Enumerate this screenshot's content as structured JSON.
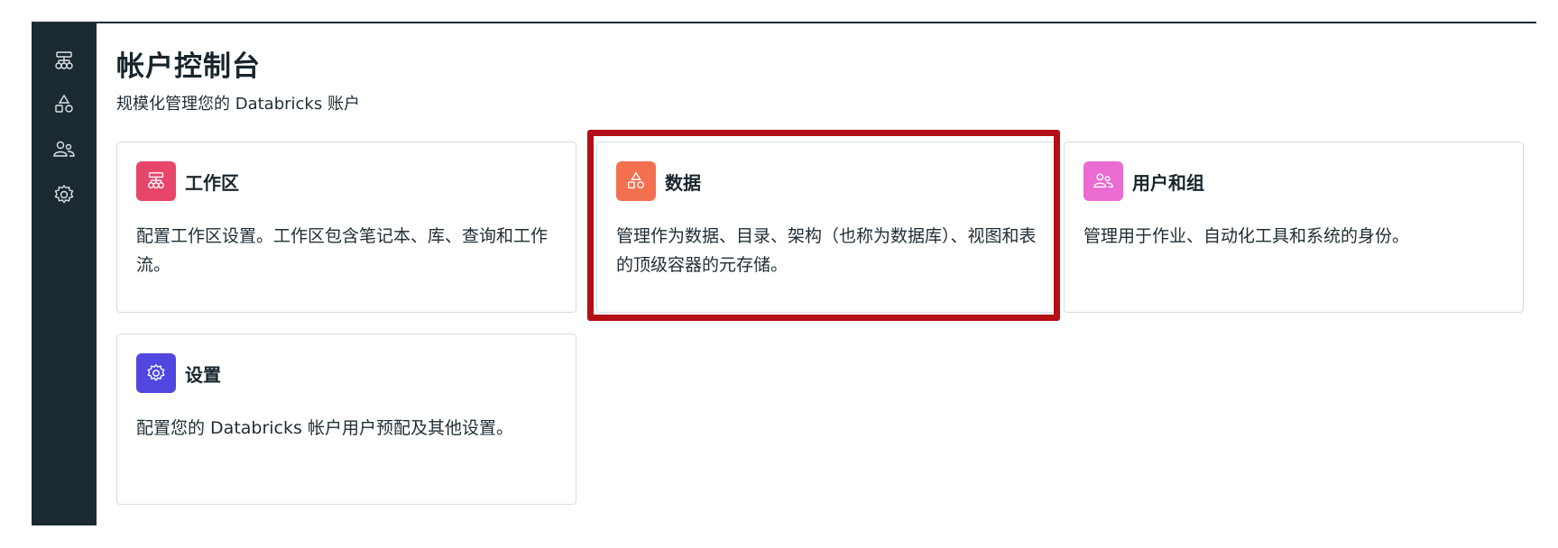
{
  "page": {
    "title": "帐户控制台",
    "subtitle": "规模化管理您的 Databricks 账户"
  },
  "sidebar": {
    "items": [
      {
        "name": "workspaces",
        "icon": "workspace-icon"
      },
      {
        "name": "data",
        "icon": "shapes-icon"
      },
      {
        "name": "users",
        "icon": "users-icon"
      },
      {
        "name": "settings",
        "icon": "gear-icon"
      }
    ]
  },
  "cards": [
    {
      "title": "工作区",
      "description": "配置工作区设置。工作区包含笔记本、库、查询和工作流。",
      "icon": "workspace-icon",
      "color": "#e8456b"
    },
    {
      "title": "数据",
      "description": "管理作为数据、目录、架构（也称为数据库）、视图和表的顶级容器的元存储。",
      "icon": "shapes-icon",
      "color": "#f2704f"
    },
    {
      "title": "用户和组",
      "description": "管理用于作业、自动化工具和系统的身份。",
      "icon": "users-icon",
      "color": "#ea6bd2"
    },
    {
      "title": "设置",
      "description": "配置您的 Databricks 帐户用户预配及其他设置。",
      "icon": "gear-icon",
      "color": "#5146e0"
    }
  ],
  "highlight": {
    "target": "数据",
    "color": "#b20f16"
  }
}
